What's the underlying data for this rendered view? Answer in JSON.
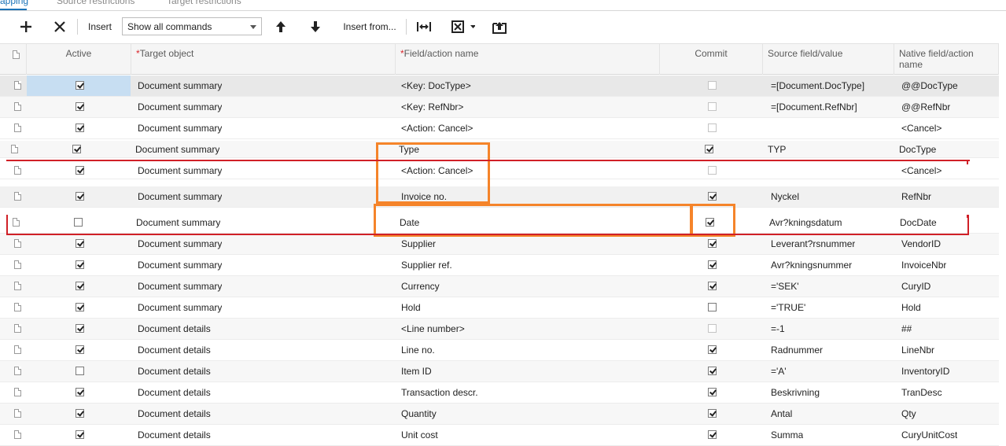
{
  "tabs": [
    {
      "label": "apping",
      "active": true
    },
    {
      "label": "Source restrictions",
      "active": false
    },
    {
      "label": "Target restrictions",
      "active": false
    }
  ],
  "toolbar": {
    "add_icon": "plus-icon",
    "delete_icon": "close-icon",
    "insert_label": "Insert",
    "command_filter": "Show all commands",
    "move_up_icon": "arrow-up-icon",
    "move_down_icon": "arrow-down-icon",
    "insert_from_label": "Insert from...",
    "fit_icon": "fit-width-icon",
    "export_icon": "excel-export-icon",
    "upload_icon": "upload-icon"
  },
  "columns": {
    "active": "Active",
    "target_object": "Target object",
    "field_action": "Field/action name",
    "commit": "Commit",
    "source": "Source field/value",
    "native": "Native field/action name"
  },
  "colors": {
    "accent": "#1a73b8",
    "highlight_orange": "#f5842a",
    "highlight_red": "#d02027",
    "selection": "#c7def2"
  },
  "rows": [
    {
      "active": true,
      "target": "Document summary",
      "field": "<Key: DocType>",
      "commit": false,
      "commit_disabled": true,
      "source": "=[Document.DocType]",
      "native": "@@DocType"
    },
    {
      "active": true,
      "target": "Document summary",
      "field": "<Key: RefNbr>",
      "commit": false,
      "commit_disabled": true,
      "source": "=[Document.RefNbr]",
      "native": "@@RefNbr"
    },
    {
      "active": true,
      "target": "Document summary",
      "field": "<Action: Cancel>",
      "commit": false,
      "commit_disabled": true,
      "source": "",
      "native": "<Cancel>"
    },
    {
      "active": true,
      "target": "Document summary",
      "field": "Type",
      "commit": true,
      "commit_disabled": false,
      "source": "TYP",
      "native": "DocType"
    },
    {
      "active": true,
      "target": "Document summary",
      "field": "<Action: Cancel>",
      "commit": false,
      "commit_disabled": true,
      "source": "",
      "native": "<Cancel>"
    },
    {
      "active": true,
      "target": "Document summary",
      "field": "Invoice no.",
      "commit": true,
      "commit_disabled": false,
      "source": "Nyckel",
      "native": "RefNbr"
    },
    {
      "active": false,
      "target": "Document summary",
      "field": "Date",
      "commit": true,
      "commit_disabled": false,
      "source": "Avr?kningsdatum",
      "native": "DocDate"
    },
    {
      "active": true,
      "target": "Document summary",
      "field": "Supplier",
      "commit": true,
      "commit_disabled": false,
      "source": "Leverant?rsnummer",
      "native": "VendorID"
    },
    {
      "active": true,
      "target": "Document summary",
      "field": "Supplier ref.",
      "commit": true,
      "commit_disabled": false,
      "source": "Avr?kningsnummer",
      "native": "InvoiceNbr"
    },
    {
      "active": true,
      "target": "Document summary",
      "field": "Currency",
      "commit": true,
      "commit_disabled": false,
      "source": "='SEK'",
      "native": "CuryID"
    },
    {
      "active": true,
      "target": "Document summary",
      "field": "Hold",
      "commit": false,
      "commit_disabled": false,
      "source": "='TRUE'",
      "native": "Hold"
    },
    {
      "active": true,
      "target": "Document details",
      "field": "<Line number>",
      "commit": false,
      "commit_disabled": true,
      "source": "=-1",
      "native": "##"
    },
    {
      "active": true,
      "target": "Document details",
      "field": "Line no.",
      "commit": true,
      "commit_disabled": false,
      "source": "Radnummer",
      "native": "LineNbr"
    },
    {
      "active": false,
      "target": "Document details",
      "field": "Item ID",
      "commit": true,
      "commit_disabled": false,
      "source": "='A'",
      "native": "InventoryID"
    },
    {
      "active": true,
      "target": "Document details",
      "field": "Transaction descr.",
      "commit": true,
      "commit_disabled": false,
      "source": "Beskrivning",
      "native": "TranDesc"
    },
    {
      "active": true,
      "target": "Document details",
      "field": "Quantity",
      "commit": true,
      "commit_disabled": false,
      "source": "Antal",
      "native": "Qty"
    },
    {
      "active": true,
      "target": "Document details",
      "field": "Unit cost",
      "commit": true,
      "commit_disabled": false,
      "source": "Summa",
      "native": "CuryUnitCost"
    }
  ]
}
